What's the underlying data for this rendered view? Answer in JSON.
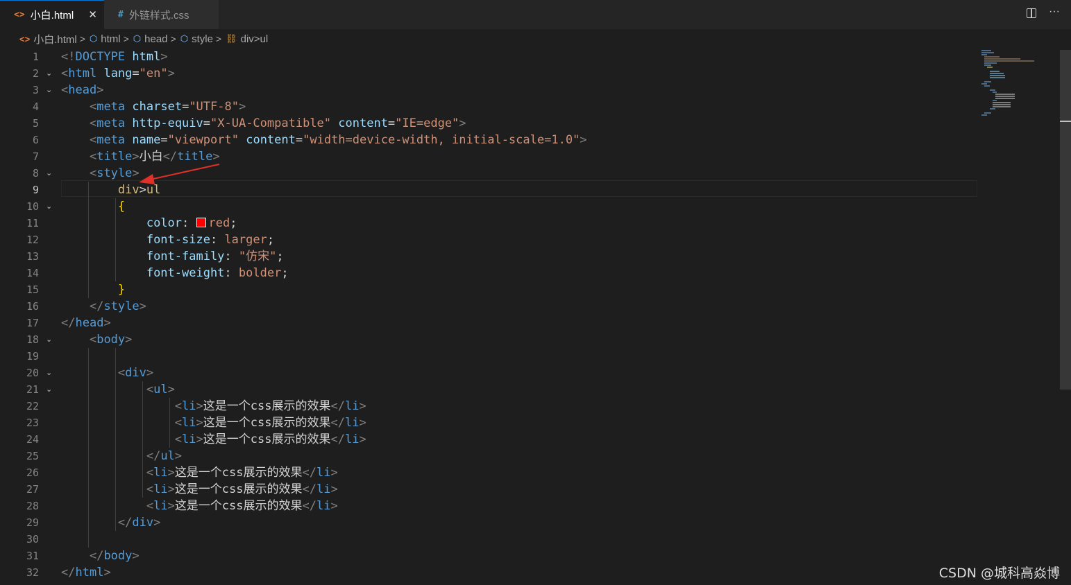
{
  "tabs": [
    {
      "icon": "<>",
      "label": "小白.html",
      "close": "✕",
      "active": true
    },
    {
      "icon": "#",
      "label": "外链样式.css",
      "active": false
    }
  ],
  "editor_actions": {
    "split": "split-editor",
    "more": "···"
  },
  "breadcrumb": [
    "小白.html",
    "html",
    "head",
    "style",
    "div>ul"
  ],
  "watermark": "CSDN @城科高焱博",
  "swatch_color": "#ff0000",
  "current_line": 9,
  "editor": {
    "line_numbers": [
      "1",
      "2",
      "3",
      "4",
      "5",
      "6",
      "7",
      "8",
      "9",
      "10",
      "11",
      "12",
      "13",
      "14",
      "15",
      "16",
      "17",
      "18",
      "19",
      "20",
      "21",
      "22",
      "23",
      "24",
      "25",
      "26",
      "27",
      "28",
      "29",
      "30",
      "31",
      "32"
    ],
    "lines": [
      "<!DOCTYPE html>",
      "<html lang=\"en\">",
      "<head>",
      "    <meta charset=\"UTF-8\">",
      "    <meta http-equiv=\"X-UA-Compatible\" content=\"IE=edge\">",
      "    <meta name=\"viewport\" content=\"width=device-width, initial-scale=1.0\">",
      "    <title>小白</title>",
      "    <style>",
      "        div>ul",
      "        {",
      "            color: red;",
      "            font-size: larger;",
      "            font-family: \"仿宋\";",
      "            font-weight: bolder;",
      "        }",
      "    </style>",
      "</head>",
      "    <body>",
      "",
      "        <div>",
      "            <ul>",
      "                <li>这是一个css展示的效果</li>",
      "                <li>这是一个css展示的效果</li>",
      "                <li>这是一个css展示的效果</li>",
      "            </ul>",
      "            <li>这是一个css展示的效果</li>",
      "            <li>这是一个css展示的效果</li>",
      "            <li>这是一个css展示的效果</li>",
      "        </div>",
      "",
      "    </body>",
      "</html>"
    ]
  }
}
